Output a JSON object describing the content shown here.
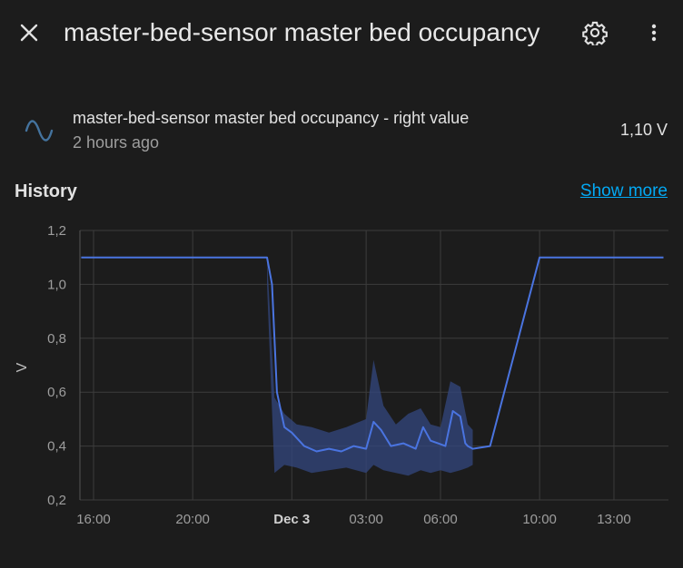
{
  "header": {
    "title": "master-bed-sensor master bed occupancy",
    "close_icon": "close-icon",
    "settings_icon": "gear-icon",
    "menu_icon": "more-vertical-icon"
  },
  "entity": {
    "icon": "sine-wave-icon",
    "name": "master-bed-sensor master bed occupancy - right value",
    "last_changed": "2 hours ago",
    "value": "1,10 V"
  },
  "history": {
    "title": "History",
    "show_more": "Show more"
  },
  "colors": {
    "accent": "#03a9f4",
    "series": "#4a74e0",
    "band": "#33477f"
  },
  "chart_data": {
    "type": "line",
    "ylabel": "V",
    "ylim": [
      0.2,
      1.2
    ],
    "y_ticks": [
      "1,2",
      "1,0",
      "0,8",
      "0,6",
      "0,4",
      "0,2"
    ],
    "x_ticks": [
      "16:00",
      "20:00",
      "Dec 3",
      "03:00",
      "06:00",
      "10:00",
      "13:00"
    ],
    "grid": true,
    "series": [
      {
        "hours": [
          15.5,
          16.2,
          17.0,
          18.0,
          19.0,
          20.0,
          21.0,
          22.0,
          23.0,
          23.2,
          23.4,
          23.7,
          24.0,
          24.5,
          25.0,
          25.5,
          26.0,
          26.5,
          27.0,
          27.3,
          27.6,
          28.0,
          28.5,
          29.0,
          29.3,
          29.6,
          29.9,
          30.2,
          30.5,
          30.8,
          31.0,
          31.1,
          31.3,
          32.0,
          34.0,
          36.0,
          38.0,
          39.0
        ],
        "values": [
          1.1,
          1.1,
          1.1,
          1.1,
          1.1,
          1.1,
          1.1,
          1.1,
          1.1,
          1.0,
          0.6,
          0.47,
          0.45,
          0.4,
          0.38,
          0.39,
          0.38,
          0.4,
          0.39,
          0.49,
          0.46,
          0.4,
          0.41,
          0.39,
          0.47,
          0.42,
          0.41,
          0.4,
          0.53,
          0.51,
          0.41,
          0.4,
          0.39,
          0.4,
          1.1,
          1.1,
          1.1,
          1.1
        ]
      }
    ],
    "band": {
      "hours": [
        23.0,
        23.3,
        23.7,
        24.2,
        24.8,
        25.5,
        26.2,
        27.0,
        27.3,
        27.7,
        28.2,
        28.7,
        29.2,
        29.6,
        30.0,
        30.4,
        30.8,
        31.1,
        31.3
      ],
      "upper": [
        1.1,
        0.58,
        0.52,
        0.48,
        0.47,
        0.45,
        0.47,
        0.5,
        0.72,
        0.55,
        0.48,
        0.52,
        0.54,
        0.48,
        0.47,
        0.64,
        0.62,
        0.48,
        0.46
      ],
      "lower": [
        1.0,
        0.3,
        0.33,
        0.32,
        0.3,
        0.31,
        0.32,
        0.3,
        0.33,
        0.31,
        0.3,
        0.29,
        0.31,
        0.3,
        0.31,
        0.3,
        0.31,
        0.32,
        0.33
      ]
    }
  }
}
